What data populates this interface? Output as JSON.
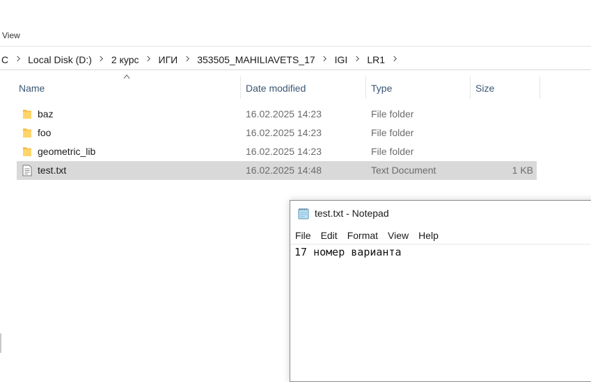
{
  "ribbon": {
    "view_tab": "View"
  },
  "breadcrumb": [
    "C",
    "Local Disk (D:)",
    "2 курс",
    "ИГИ",
    "353505_MAHILIAVETS_17",
    "IGI",
    "LR1"
  ],
  "columns": {
    "name": "Name",
    "date": "Date modified",
    "type": "Type",
    "size": "Size"
  },
  "files": [
    {
      "name": "baz",
      "date": "16.02.2025 14:23",
      "type": "File folder",
      "size": "",
      "icon": "folder-icon"
    },
    {
      "name": "foo",
      "date": "16.02.2025 14:23",
      "type": "File folder",
      "size": "",
      "icon": "folder-icon"
    },
    {
      "name": "geometric_lib",
      "date": "16.02.2025 14:23",
      "type": "File folder",
      "size": "",
      "icon": "folder-icon"
    },
    {
      "name": "test.txt",
      "date": "16.02.2025 14:48",
      "type": "Text Document",
      "size": "1 KB",
      "icon": "text-file-icon",
      "selected": true
    }
  ],
  "notepad": {
    "title": "test.txt - Notepad",
    "menu": [
      "File",
      "Edit",
      "Format",
      "View",
      "Help"
    ],
    "content": "17 номер варианта"
  },
  "colors": {
    "selected_row": "#d9d9d9",
    "header_text": "#3b5574",
    "folder": "#f5c04a"
  }
}
